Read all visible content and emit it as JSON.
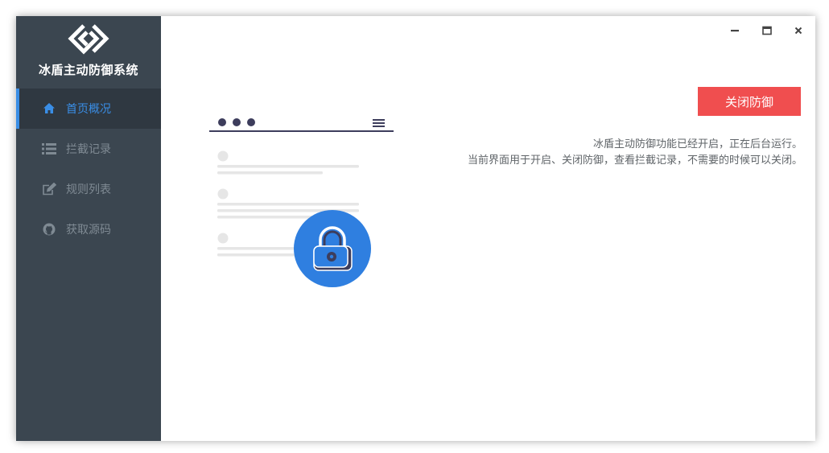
{
  "app": {
    "title": "冰盾主动防御系统",
    "logo_icon": "diamond-link-logo"
  },
  "sidebar": {
    "items": [
      {
        "label": "首页概况",
        "icon": "home-icon",
        "active": true
      },
      {
        "label": "拦截记录",
        "icon": "list-icon",
        "active": false
      },
      {
        "label": "规则列表",
        "icon": "edit-icon",
        "active": false
      },
      {
        "label": "获取源码",
        "icon": "github-icon",
        "active": false
      }
    ]
  },
  "window_controls": [
    "minimize-icon",
    "maximize-icon",
    "close-icon"
  ],
  "main": {
    "toggle_button_label": "关闭防御",
    "status_line_1": "冰盾主动防御功能已经开启，正在后台运行。",
    "status_line_2": "当前界面用于开启、关闭防御，查看拦截记录，不需要的时候可以关闭。"
  },
  "colors": {
    "sidebar_bg": "#3b4650",
    "active_bg": "#2f3841",
    "accent": "#3a8ee6",
    "danger": "#f04e4f"
  }
}
